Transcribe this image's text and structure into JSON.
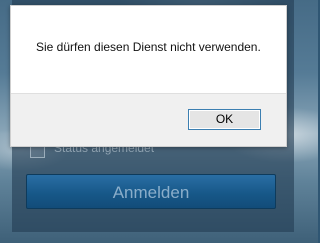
{
  "dialog": {
    "message": "Sie dürfen diesen Dienst nicht verwenden.",
    "ok_label": "OK"
  },
  "login": {
    "remember_label": "Status angemeldet",
    "submit_label": "Anmelden"
  },
  "colors": {
    "login_button": "#175889",
    "ok_button_border": "#3c7fb1",
    "dialog_footer": "#f0f0f0"
  }
}
